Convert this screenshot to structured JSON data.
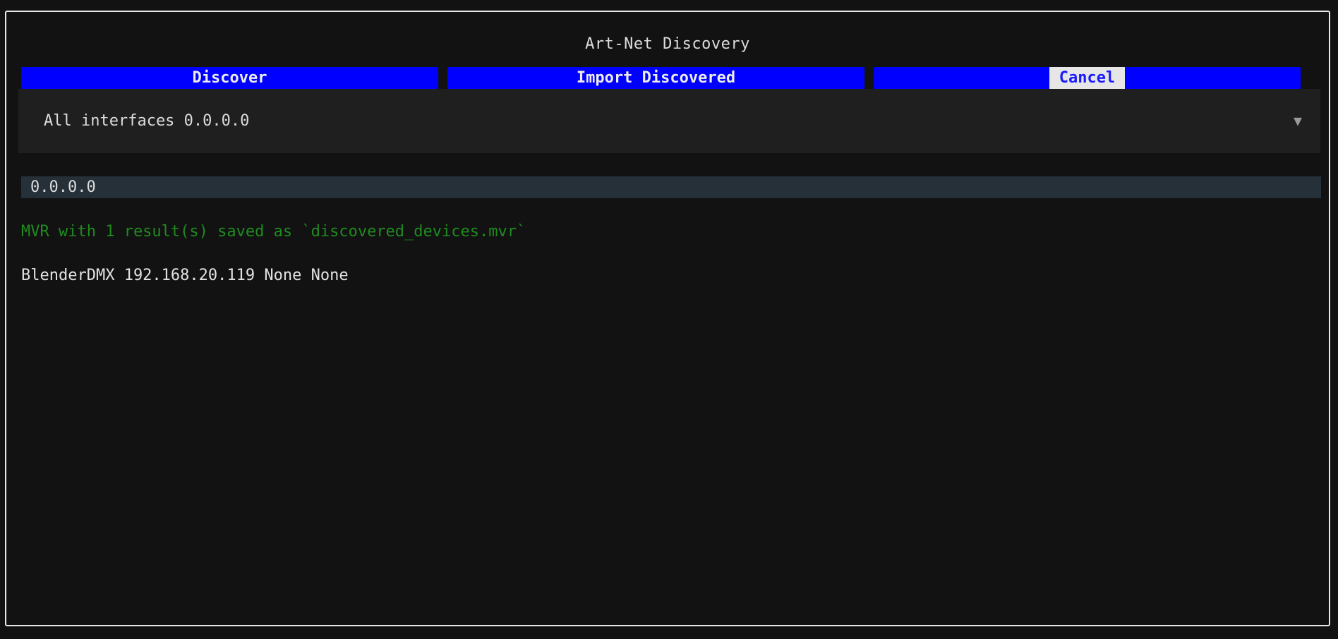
{
  "dialog": {
    "title": "Art-Net Discovery"
  },
  "toolbar": {
    "discover_label": "Discover",
    "import_label": "Import Discovered",
    "cancel_label": "Cancel"
  },
  "interface_select": {
    "selected": "All interfaces 0.0.0.0",
    "arrow_icon": "triangle-down-icon"
  },
  "address_input": {
    "value": "0.0.0.0"
  },
  "status": {
    "message": "MVR with 1 result(s) saved as `discovered_devices.mvr`",
    "color": "#1f8b1f"
  },
  "results": [
    {
      "text": "BlenderDMX 192.168.20.119 None None"
    }
  ],
  "colors": {
    "background": "#121212",
    "button_bg": "#0000ff",
    "button_text": "#ededed",
    "dropdown_bg": "#1f1f1f",
    "input_bg": "#253039",
    "border": "#e8e8e8"
  }
}
